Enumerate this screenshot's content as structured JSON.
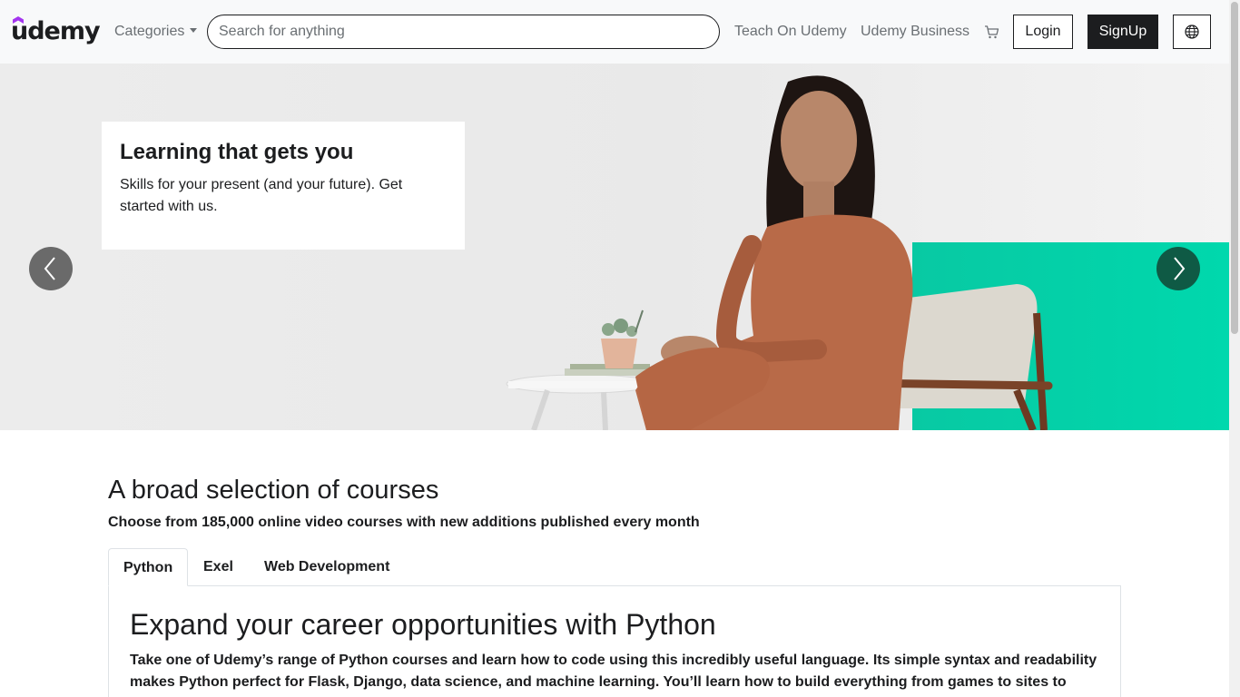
{
  "navbar": {
    "logo_text": "udemy",
    "categories_label": "Categories",
    "search_placeholder": "Search for anything",
    "teach_link": "Teach On Udemy",
    "business_link": "Udemy Business",
    "cart_icon": "cart-icon",
    "login_label": "Login",
    "signup_label": "SignUp",
    "language_icon": "globe-icon"
  },
  "hero": {
    "title": "Learning that gets you",
    "subtitle": "Skills for your present (and your future). Get started with us.",
    "prev_icon": "chevron-left-icon",
    "next_icon": "chevron-right-icon",
    "accent_color": "#00d1a8"
  },
  "courses": {
    "title": "A broad selection of courses",
    "subtitle": "Choose from 185,000 online video courses with new additions published every month",
    "tabs": [
      {
        "label": "Python",
        "active": true
      },
      {
        "label": "Exel",
        "active": false
      },
      {
        "label": "Web Development",
        "active": false
      }
    ],
    "panel": {
      "title": "Expand your career opportunities with Python",
      "text": "Take one of Udemy’s range of Python courses and learn how to code using this incredibly useful language. Its simple syntax and readability makes Python perfect for Flask, Django, data science, and machine learning. You’ll learn how to build everything from games to sites to"
    }
  },
  "colors": {
    "brand_purple": "#a435f0",
    "dark": "#1c1d1f",
    "muted": "#6a6f73"
  }
}
